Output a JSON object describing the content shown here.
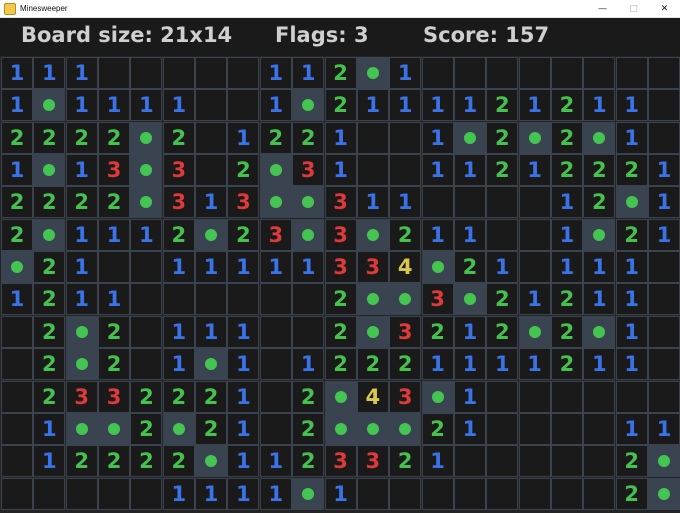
{
  "window": {
    "title": "Minesweeper",
    "minimize": "—",
    "maximize": "□",
    "close": "✕"
  },
  "header": {
    "board_size": "Board size: 21x14",
    "flags": "Flags: 3",
    "score": "Score: 157"
  },
  "colors": {
    "1": "#3a73e8",
    "2": "#45c24e",
    "3": "#df3a3a",
    "4": "#d9c84a",
    "mine": "#44c552",
    "mine_bg": "#3a4451",
    "cell_bg": "#1a1a1a",
    "grid": "#3a4350"
  },
  "board": {
    "cols": 21,
    "rows": [
      [
        "1",
        "1",
        "1",
        "",
        "",
        "",
        "",
        "",
        "1",
        "1",
        "2",
        "*",
        "1",
        "",
        "",
        "",
        "",
        "",
        "",
        "",
        ""
      ],
      [
        "1",
        "*",
        "1",
        "1",
        "1",
        "1",
        "",
        "",
        "1",
        "*",
        "2",
        "1",
        "1",
        "1",
        "1",
        "2",
        "1",
        "2",
        "1",
        "1",
        ""
      ],
      [
        "2",
        "2",
        "2",
        "2",
        "*",
        "2",
        "",
        "1",
        "2",
        "2",
        "1",
        "",
        "",
        "1",
        "*",
        "2",
        "*",
        "2",
        "*",
        "1",
        ""
      ],
      [
        "1",
        "*",
        "1",
        "3",
        "*",
        "3",
        "",
        "2",
        "*",
        "3",
        "1",
        "",
        "",
        "1",
        "1",
        "2",
        "1",
        "2",
        "2",
        "2",
        "1"
      ],
      [
        "2",
        "2",
        "2",
        "2",
        "*",
        "3",
        "1",
        "3",
        "*",
        "*",
        "3",
        "1",
        "1",
        "",
        "",
        "",
        "",
        "1",
        "2",
        "*",
        "1"
      ],
      [
        "2",
        "*",
        "1",
        "1",
        "1",
        "2",
        "*",
        "2",
        "3",
        "*",
        "3",
        "*",
        "2",
        "1",
        "1",
        "",
        "",
        "1",
        "*",
        "2",
        "1"
      ],
      [
        "*",
        "2",
        "1",
        "",
        "",
        "1",
        "1",
        "1",
        "1",
        "1",
        "3",
        "3",
        "4",
        "*",
        "2",
        "1",
        "",
        "1",
        "1",
        "1",
        ""
      ],
      [
        "1",
        "2",
        "1",
        "1",
        "",
        "",
        "",
        "",
        "",
        "",
        "2",
        "*",
        "*",
        "3",
        "*",
        "2",
        "1",
        "2",
        "1",
        "1",
        ""
      ],
      [
        "",
        "2",
        "*",
        "2",
        "",
        "1",
        "1",
        "1",
        "",
        "",
        "2",
        "*",
        "3",
        "2",
        "1",
        "2",
        "*",
        "2",
        "*",
        "1",
        ""
      ],
      [
        "",
        "2",
        "*",
        "2",
        "",
        "1",
        "*",
        "1",
        "",
        "1",
        "2",
        "2",
        "2",
        "1",
        "1",
        "1",
        "1",
        "2",
        "1",
        "1",
        ""
      ],
      [
        "",
        "2",
        "3",
        "3",
        "2",
        "2",
        "2",
        "1",
        "",
        "2",
        "*",
        "4",
        "3",
        "*",
        "1",
        "",
        "",
        "",
        "",
        "",
        ""
      ],
      [
        "",
        "1",
        "*",
        "*",
        "2",
        "*",
        "2",
        "1",
        "",
        "2",
        "*",
        "*",
        "*",
        "2",
        "1",
        "",
        "",
        "",
        "",
        "1",
        "1"
      ],
      [
        "",
        "1",
        "2",
        "2",
        "2",
        "2",
        "*",
        "1",
        "1",
        "2",
        "3",
        "3",
        "2",
        "1",
        "",
        "",
        "",
        "",
        "",
        "2",
        "*"
      ],
      [
        "",
        "",
        "",
        "",
        "",
        "1",
        "1",
        "1",
        "1",
        "*",
        "1",
        "",
        "",
        "",
        "",
        "",
        "",
        "",
        "",
        "2",
        "*"
      ]
    ]
  }
}
